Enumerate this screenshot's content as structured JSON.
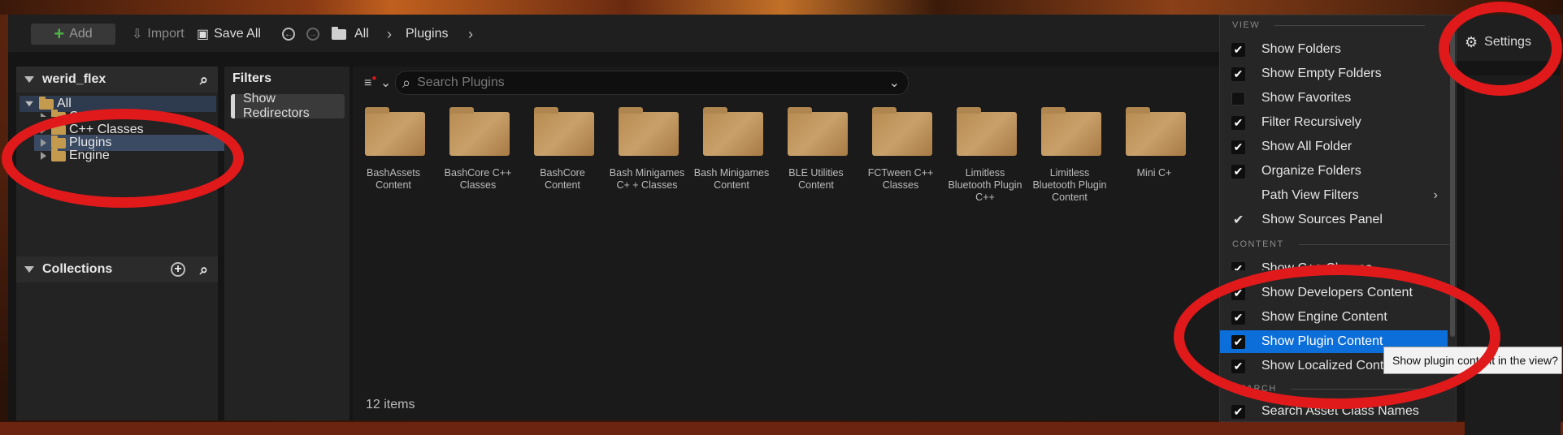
{
  "toolbar": {
    "add_label": "Add",
    "import_label": "Import",
    "save_all_label": "Save All",
    "breadcrumb": [
      "All",
      "Plugins"
    ],
    "settings_label": "Settings"
  },
  "sources": {
    "project_name": "werid_flex",
    "tree": [
      {
        "label": "All"
      },
      {
        "label": "Content"
      },
      {
        "label": "C++ Classes"
      },
      {
        "label": "Plugins"
      },
      {
        "label": "Engine"
      }
    ],
    "collections_label": "Collections"
  },
  "filters": {
    "title": "Filters",
    "items": [
      "Show Redirectors"
    ]
  },
  "search": {
    "placeholder": "Search Plugins"
  },
  "folders": [
    "BashAssets Content",
    "BashCore C++ Classes",
    "BashCore Content",
    "Bash Minigames C+ + Classes",
    "Bash Minigames Content",
    "BLE Utilities Content",
    "FCTween C++ Classes",
    "Limitless Bluetooth Plugin C++",
    "Limitless Bluetooth Plugin Content",
    "Mini C+"
  ],
  "status": {
    "item_count": "12 items"
  },
  "settings_menu": {
    "view_section": "VIEW",
    "view_items": [
      {
        "label": "Show Folders",
        "checked": true
      },
      {
        "label": "Show Empty Folders",
        "checked": true
      },
      {
        "label": "Show Favorites",
        "checked": false
      },
      {
        "label": "Filter Recursively",
        "checked": true
      },
      {
        "label": "Show All Folder",
        "checked": true
      },
      {
        "label": "Organize Folders",
        "checked": true
      },
      {
        "label": "Path View Filters",
        "checked": null
      },
      {
        "label": "Show Sources Panel",
        "checked": true
      }
    ],
    "content_section": "CONTENT",
    "content_items": [
      {
        "label": "Show C++ Classes",
        "checked": true
      },
      {
        "label": "Show Developers Content",
        "checked": true
      },
      {
        "label": "Show Engine Content",
        "checked": true
      },
      {
        "label": "Show Plugin Content",
        "checked": true
      },
      {
        "label": "Show Localized Content",
        "checked": true
      }
    ],
    "search_section": "SEARCH",
    "search_items": [
      {
        "label": "Search Asset Class Names",
        "checked": true
      }
    ]
  },
  "tooltip": {
    "text": "Show plugin content in the view?"
  },
  "colors": {
    "annotation": "#e0191b",
    "selection": "#0c6ed8",
    "folder": "#c49a4f",
    "add_plus": "#4fb348"
  }
}
